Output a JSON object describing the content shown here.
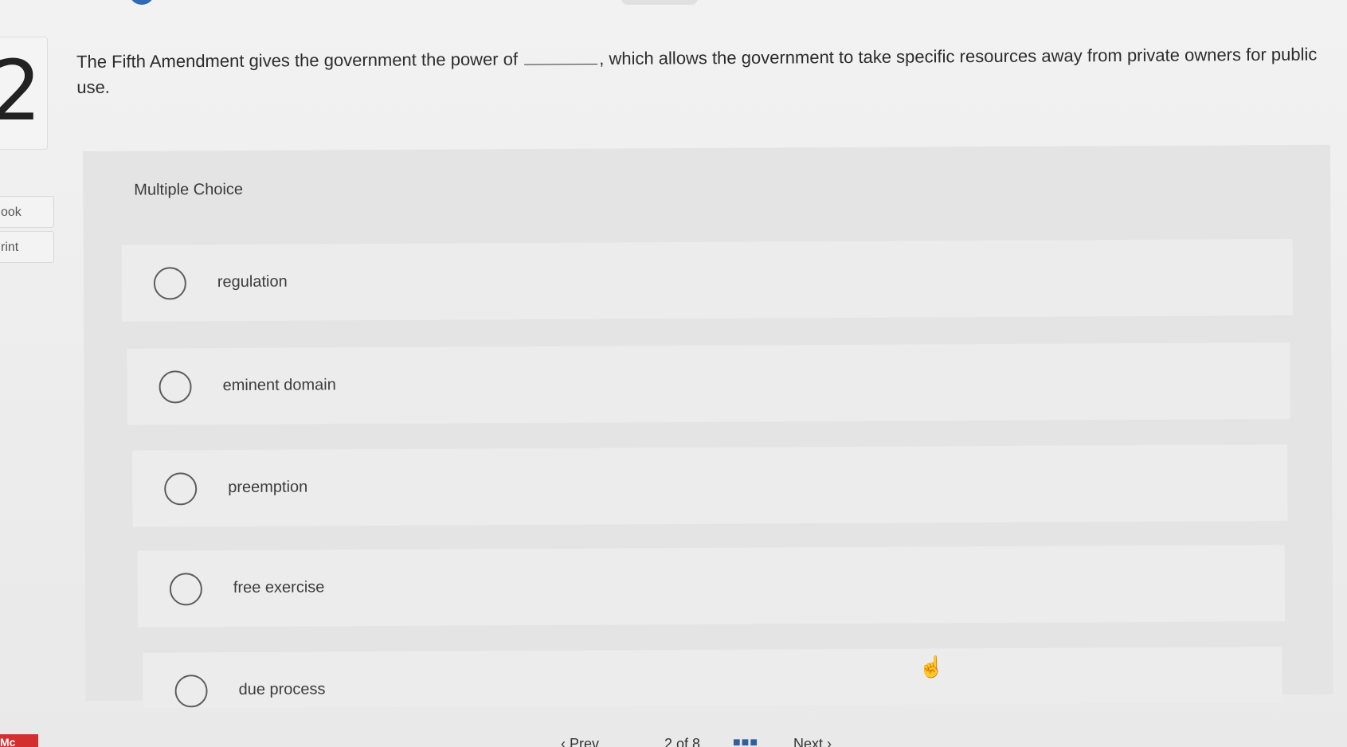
{
  "question": {
    "number": "2",
    "text_before": "The Fifth Amendment gives the government the power of",
    "text_after": ", which allows the government to take specific resources away from private owners for public use."
  },
  "side_tools": {
    "ebook_label": "ook",
    "print_label": "rint"
  },
  "answer_panel": {
    "type_label": "Multiple Choice",
    "options": [
      {
        "label": "regulation"
      },
      {
        "label": "eminent domain"
      },
      {
        "label": "preemption"
      },
      {
        "label": "free exercise"
      },
      {
        "label": "due process"
      }
    ]
  },
  "bottom_nav": {
    "brand_badge": "Mc",
    "prev_label": "‹ Prev",
    "page_count": "2 of 8",
    "grid_icon": "grid-icon",
    "next_label": "Next ›"
  },
  "colors": {
    "accent_blue": "#2f6ab2",
    "brand_red": "#d32f2f"
  }
}
